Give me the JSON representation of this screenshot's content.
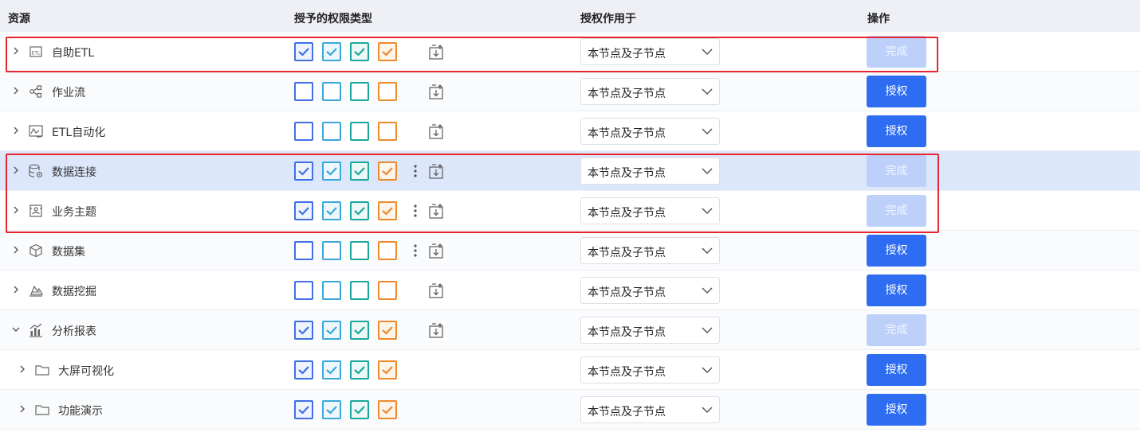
{
  "header": {
    "resource": "资源",
    "permission_types": "授予的权限类型",
    "scope": "授权作用于",
    "operation": "操作"
  },
  "colors": {
    "perm1": "#3f6fe8",
    "perm2": "#3aa7dc",
    "perm3": "#1aa89c",
    "perm4": "#ef8a2c",
    "grant_button": "#2e6cf2",
    "done_button": "#bcd0fa",
    "highlight_border": "#e8252f"
  },
  "rows": [
    {
      "label": "自助ETL",
      "icon": "etl-icon",
      "expander": "collapsed",
      "level": 0,
      "perms": [
        true,
        true,
        true,
        true
      ],
      "has_more": false,
      "has_inherit": true,
      "scope": "本节点及子节点",
      "button": "完成",
      "button_state": "done"
    },
    {
      "label": "作业流",
      "icon": "workflow-icon",
      "expander": "collapsed",
      "level": 0,
      "perms": [
        false,
        false,
        false,
        false
      ],
      "has_more": false,
      "has_inherit": true,
      "scope": "本节点及子节点",
      "button": "授权",
      "button_state": "grant"
    },
    {
      "label": "ETL自动化",
      "icon": "etl-automation-icon",
      "expander": "collapsed",
      "level": 0,
      "perms": [
        false,
        false,
        false,
        false
      ],
      "has_more": false,
      "has_inherit": true,
      "scope": "本节点及子节点",
      "button": "授权",
      "button_state": "grant"
    },
    {
      "label": "数据连接",
      "icon": "database-gear-icon",
      "expander": "collapsed",
      "level": 0,
      "perms": [
        true,
        true,
        true,
        true
      ],
      "has_more": true,
      "has_inherit": true,
      "scope": "本节点及子节点",
      "button": "完成",
      "button_state": "done",
      "selected": true
    },
    {
      "label": "业务主题",
      "icon": "business-topic-icon",
      "expander": "collapsed",
      "level": 0,
      "perms": [
        true,
        true,
        true,
        true
      ],
      "has_more": true,
      "has_inherit": true,
      "scope": "本节点及子节点",
      "button": "完成",
      "button_state": "done"
    },
    {
      "label": "数据集",
      "icon": "cube-icon",
      "expander": "collapsed",
      "level": 0,
      "perms": [
        false,
        false,
        false,
        false
      ],
      "has_more": true,
      "has_inherit": true,
      "scope": "本节点及子节点",
      "button": "授权",
      "button_state": "grant"
    },
    {
      "label": "数据挖掘",
      "icon": "data-mining-icon",
      "expander": "collapsed",
      "level": 0,
      "perms": [
        false,
        false,
        false,
        false
      ],
      "has_more": false,
      "has_inherit": true,
      "scope": "本节点及子节点",
      "button": "授权",
      "button_state": "grant"
    },
    {
      "label": "分析报表",
      "icon": "bar-chart-icon",
      "expander": "expanded",
      "level": 0,
      "perms": [
        true,
        true,
        true,
        true
      ],
      "has_more": false,
      "has_inherit": true,
      "scope": "本节点及子节点",
      "button": "完成",
      "button_state": "done"
    },
    {
      "label": "大屏可视化",
      "icon": "folder-icon",
      "expander": "collapsed",
      "level": 1,
      "perms": [
        true,
        true,
        true,
        true
      ],
      "has_more": false,
      "has_inherit": false,
      "scope": "本节点及子节点",
      "button": "授权",
      "button_state": "grant"
    },
    {
      "label": "功能演示",
      "icon": "folder-icon",
      "expander": "collapsed",
      "level": 1,
      "perms": [
        true,
        true,
        true,
        true
      ],
      "has_more": false,
      "has_inherit": false,
      "scope": "本节点及子节点",
      "button": "授权",
      "button_state": "grant"
    }
  ]
}
